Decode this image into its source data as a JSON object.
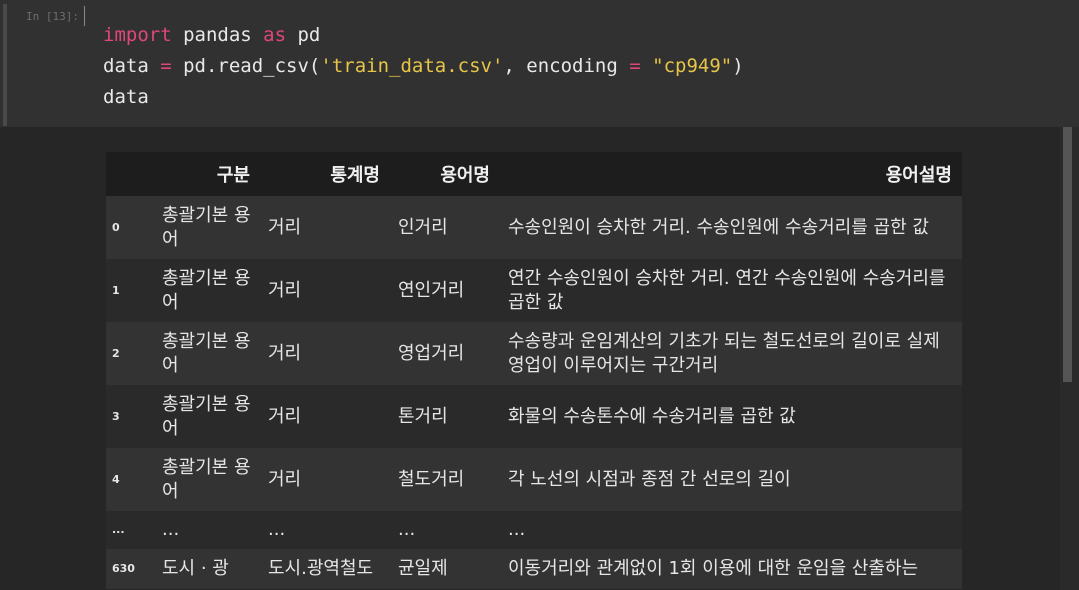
{
  "prompt": "In [13]:",
  "code": {
    "line1": {
      "kw1": "import",
      "mid": " pandas ",
      "kw2": "as",
      "end": " pd"
    },
    "line2": {
      "a": "data ",
      "eq1": "=",
      "b": " pd.read_csv(",
      "str1": "'train_data.csv'",
      "c": ", encoding ",
      "eq2": "=",
      "d": " ",
      "str2": "\"cp949\"",
      "e": ")"
    },
    "line3": "data"
  },
  "table": {
    "headers": [
      "구분",
      "통계명",
      "용어명",
      "용어설명"
    ],
    "rows": [
      {
        "idx": "0",
        "c1": "총괄기본 용어",
        "c2": "거리",
        "c3": "인거리",
        "c4": "수송인원이 승차한 거리. 수송인원에 수송거리를 곱한 값"
      },
      {
        "idx": "1",
        "c1": "총괄기본 용어",
        "c2": "거리",
        "c3": "연인거리",
        "c4": "연간 수송인원이 승차한 거리. 연간 수송인원에 수송거리를 곱한 값"
      },
      {
        "idx": "2",
        "c1": "총괄기본 용어",
        "c2": "거리",
        "c3": "영업거리",
        "c4": "수송량과 운임계산의 기초가 되는 철도선로의 길이로 실제영업이 이루어지는 구간거리"
      },
      {
        "idx": "3",
        "c1": "총괄기본 용어",
        "c2": "거리",
        "c3": "톤거리",
        "c4": "화물의 수송톤수에 수송거리를 곱한 값"
      },
      {
        "idx": "4",
        "c1": "총괄기본 용어",
        "c2": "거리",
        "c3": "철도거리",
        "c4": "각 노선의 시점과 종점 간 선로의 길이"
      }
    ],
    "ellipsis": {
      "idx": "...",
      "c1": "...",
      "c2": "...",
      "c3": "...",
      "c4": "..."
    },
    "partial": {
      "idx": "630",
      "c1": "도시 · 광",
      "c2": "도시.광역철도",
      "c3": "균일제",
      "c4": "이동거리와 관계없이 1회 이용에 대한 운임을 산출하는"
    }
  }
}
